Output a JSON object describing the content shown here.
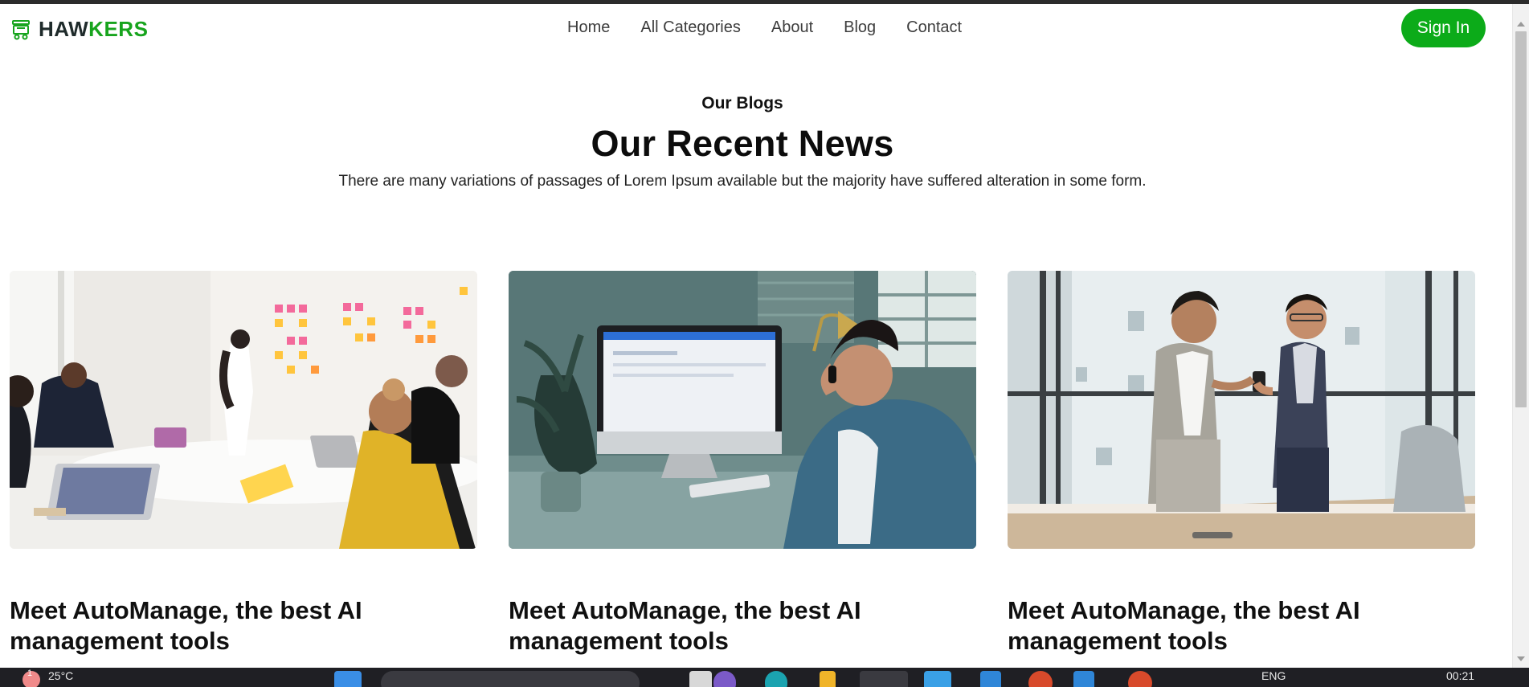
{
  "brand": {
    "name_part1": "HAW",
    "name_part2": "KERS"
  },
  "nav": {
    "items": [
      "Home",
      "All Categories",
      "About",
      "Blog",
      "Contact"
    ],
    "signin_label": "Sign In"
  },
  "section": {
    "eyebrow": "Our Blogs",
    "title": "Our Recent News",
    "subtitle": "There are many variations of passages of Lorem Ipsum available but the majority have suffered alteration in some form."
  },
  "posts": [
    {
      "title": "Meet AutoManage, the best AI management tools"
    },
    {
      "title": "Meet AutoManage, the best AI management tools"
    },
    {
      "title": "Meet AutoManage, the best AI management tools"
    }
  ],
  "taskbar": {
    "weather": "25°C",
    "language": "ENG",
    "time": "00:21",
    "notification_count": "1"
  },
  "colors": {
    "brand_green": "#17a41d",
    "button_green": "#0cab19",
    "text_dark": "#0c0c0c"
  }
}
